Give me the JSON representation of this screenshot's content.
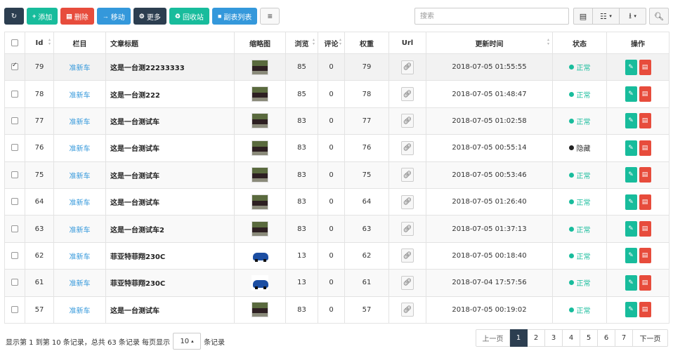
{
  "toolbar": {
    "add_label": "添加",
    "delete_label": "删除",
    "move_label": "移动",
    "more_label": "更多",
    "recycle_label": "回收站",
    "sublist_label": "副表列表"
  },
  "search": {
    "placeholder": "搜索"
  },
  "table": {
    "headers": {
      "id": "Id",
      "column": "栏目",
      "title": "文章标题",
      "thumb": "缩略图",
      "views": "浏览",
      "comments": "评论",
      "weight": "权重",
      "url": "Url",
      "updated": "更新时间",
      "status": "状态",
      "actions": "操作"
    },
    "rows": [
      {
        "id": "79",
        "column": "准新车",
        "title": "这是一台测22233333",
        "thumb": "van",
        "views": "85",
        "comments": "0",
        "weight": "79",
        "updated": "2018-07-05 01:55:55",
        "status": "正常",
        "status_kind": "ok",
        "checked": true
      },
      {
        "id": "78",
        "column": "准新车",
        "title": "这是一台测222",
        "thumb": "van",
        "views": "85",
        "comments": "0",
        "weight": "78",
        "updated": "2018-07-05 01:48:47",
        "status": "正常",
        "status_kind": "ok",
        "checked": false
      },
      {
        "id": "77",
        "column": "准新车",
        "title": "这是一台测试车",
        "thumb": "van",
        "views": "83",
        "comments": "0",
        "weight": "77",
        "updated": "2018-07-05 01:02:58",
        "status": "正常",
        "status_kind": "ok",
        "checked": false
      },
      {
        "id": "76",
        "column": "准新车",
        "title": "这是一台测试车",
        "thumb": "van",
        "views": "83",
        "comments": "0",
        "weight": "76",
        "updated": "2018-07-05 00:55:14",
        "status": "隐藏",
        "status_kind": "hidden",
        "checked": false
      },
      {
        "id": "75",
        "column": "准新车",
        "title": "这是一台测试车",
        "thumb": "van",
        "views": "83",
        "comments": "0",
        "weight": "75",
        "updated": "2018-07-05 00:53:46",
        "status": "正常",
        "status_kind": "ok",
        "checked": false
      },
      {
        "id": "64",
        "column": "准新车",
        "title": "这是一台测试车",
        "thumb": "van",
        "views": "83",
        "comments": "0",
        "weight": "64",
        "updated": "2018-07-05 01:26:40",
        "status": "正常",
        "status_kind": "ok",
        "checked": false
      },
      {
        "id": "63",
        "column": "准新车",
        "title": "这是一台测试车2",
        "thumb": "van",
        "views": "83",
        "comments": "0",
        "weight": "63",
        "updated": "2018-07-05 01:37:13",
        "status": "正常",
        "status_kind": "ok",
        "checked": false
      },
      {
        "id": "62",
        "column": "准新车",
        "title": "菲亚特菲翔230C",
        "thumb": "car",
        "views": "13",
        "comments": "0",
        "weight": "62",
        "updated": "2018-07-05 00:18:40",
        "status": "正常",
        "status_kind": "ok",
        "checked": false
      },
      {
        "id": "61",
        "column": "准新车",
        "title": "菲亚特菲翔230C",
        "thumb": "car",
        "views": "13",
        "comments": "0",
        "weight": "61",
        "updated": "2018-07-04 17:57:56",
        "status": "正常",
        "status_kind": "ok",
        "checked": false
      },
      {
        "id": "57",
        "column": "准新车",
        "title": "这是一台测试车",
        "thumb": "van",
        "views": "83",
        "comments": "0",
        "weight": "57",
        "updated": "2018-07-05 00:19:02",
        "status": "正常",
        "status_kind": "ok",
        "checked": false
      }
    ]
  },
  "footer": {
    "info_prefix": "显示第 1 到第 10 条记录，总共 63 条记录 每页显示",
    "page_size": "10",
    "info_suffix": "条记录"
  },
  "pagination": {
    "prev": "上一页",
    "pages": [
      "1",
      "2",
      "3",
      "4",
      "5",
      "6",
      "7"
    ],
    "active": "1",
    "next": "下一页"
  },
  "colors": {
    "primary": "#2c3e50",
    "success": "#18bc9c",
    "danger": "#e74c3c",
    "info": "#3498db"
  }
}
